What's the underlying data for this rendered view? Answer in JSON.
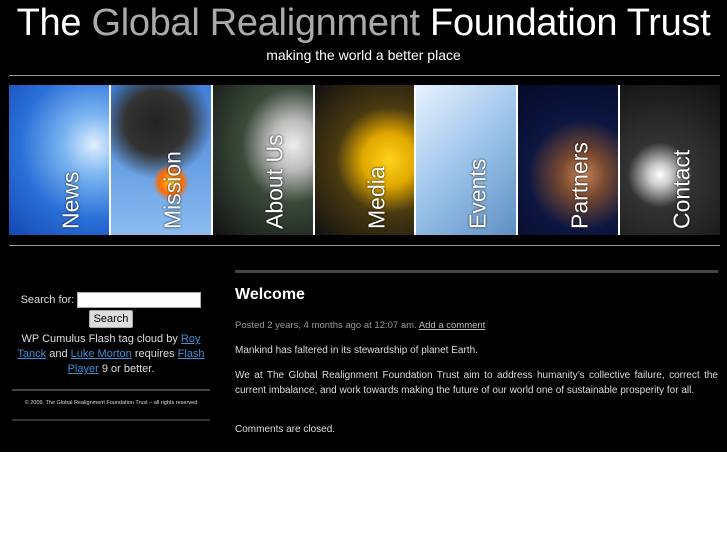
{
  "header": {
    "title_part1": "The",
    "title_part2": "Global Realignment",
    "title_part3": "Foundation Trust",
    "tagline": "making the world a better place"
  },
  "nav": [
    {
      "label": "News",
      "bg": "radial-gradient(circle at 85% 40%,#dfefff 0,#7ab4f0 25%,#2a6fd8 60%,#1448b0 100%)"
    },
    {
      "label": "Mission",
      "bg": "radial-gradient(circle at 60% 65%,#ffcc33 0,#ff6a00 10%,transparent 16%),radial-gradient(circle at 45% 25%,#222 0,#333 25%,transparent 45%),linear-gradient(#3f7fd8,#8bbcf0)"
    },
    {
      "label": "About Us",
      "bg": "radial-gradient(ellipse at 80% 40%,#eee 0,#bbb 20%,#3a4a3a 45%,#111 100%)"
    },
    {
      "label": "Media",
      "bg": "radial-gradient(circle at 75% 50%,#ffd21a 0,#e0a800 25%,#4a3a10 50%,#111 100%)"
    },
    {
      "label": "Events",
      "bg": "linear-gradient(135deg,#e8f2ff,#9cc4ea 50%,#5d8fc4)"
    },
    {
      "label": "Partners",
      "bg": "radial-gradient(circle at 65% 60%,#c8865a 0,#7a4a30 20%,#0c1640 50%,#050a28 100%)"
    },
    {
      "label": "Contact",
      "bg": "radial-gradient(circle at 40% 60%,#fff 0,#ccc 10%,#333 30%,#111 100%)"
    }
  ],
  "sidebar": {
    "search_label": "Search for:",
    "search_value": "",
    "search_button": "Search",
    "cumulus": {
      "t1": "WP Cumulus Flash tag cloud by ",
      "l1": "Roy Tanck",
      "t2": " and ",
      "l2": "Luke Morton",
      "t3": " requires ",
      "l3": "Flash Player",
      "t4": " 9 or better."
    },
    "footer": "© 2009, The Global Realignment Foundation Trust – all rights reserved"
  },
  "post": {
    "title": "Welcome",
    "meta": "Posted 2 years, 4 months ago at 12:07 am. ",
    "add_comment": "Add a comment",
    "p1": "Mankind has faltered in its stewardship of planet Earth.",
    "p2": "We at The Global Realignment Foundation Trust aim to address humanity’s collective failure, correct the current imbalance, and work towards making the future of our world one of sustainable prosperity for all.",
    "closed": "Comments are closed."
  }
}
